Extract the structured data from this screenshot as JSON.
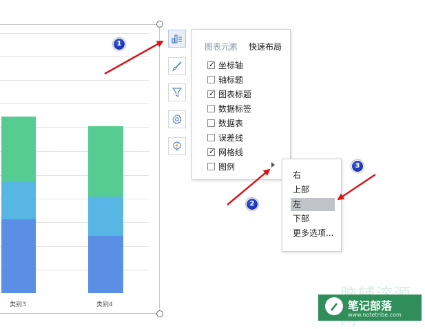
{
  "chart": {
    "categories": [
      "类别3",
      "类别4"
    ],
    "series": [
      {
        "values": [
          4.5,
          3.5
        ],
        "color": "#5b8fe6"
      },
      {
        "values": [
          2.3,
          2.4
        ],
        "color": "#58b6e4"
      },
      {
        "values": [
          4.0,
          4.3
        ],
        "color": "#56cc93"
      }
    ]
  },
  "toolbar": {
    "items": [
      {
        "icon": "chart-elements-icon",
        "active": true
      },
      {
        "icon": "brush-icon",
        "active": false
      },
      {
        "icon": "filter-icon",
        "active": false
      },
      {
        "icon": "settings-icon",
        "active": false
      },
      {
        "icon": "lightbulb-icon",
        "active": false
      }
    ]
  },
  "panel": {
    "tabs": [
      {
        "label": "图表元素",
        "active": false
      },
      {
        "label": "快速布局",
        "active": true
      }
    ],
    "items": [
      {
        "label": "坐标轴",
        "checked": true
      },
      {
        "label": "轴标题",
        "checked": false
      },
      {
        "label": "图表标题",
        "checked": true
      },
      {
        "label": "数据标签",
        "checked": false
      },
      {
        "label": "数据表",
        "checked": false
      },
      {
        "label": "误差线",
        "checked": false
      },
      {
        "label": "网格线",
        "checked": true
      },
      {
        "label": "图例",
        "checked": false
      }
    ],
    "check_glyph": "✓"
  },
  "submenu": {
    "items": [
      {
        "label": "右",
        "highlighted": false
      },
      {
        "label": "上部",
        "highlighted": false
      },
      {
        "label": "左",
        "highlighted": true
      },
      {
        "label": "下部",
        "highlighted": false
      },
      {
        "label": "更多选项...",
        "highlighted": false
      }
    ]
  },
  "callouts": [
    "1",
    "2",
    "3"
  ],
  "watermark": {
    "faded_text": "脑辅溶源网",
    "brand_name": "笔记部落",
    "brand_url": "www.notetribe.com"
  },
  "colors": {
    "arrow": "#d9161a",
    "callout": "#1530b8",
    "brand": "#2f8e5a"
  }
}
